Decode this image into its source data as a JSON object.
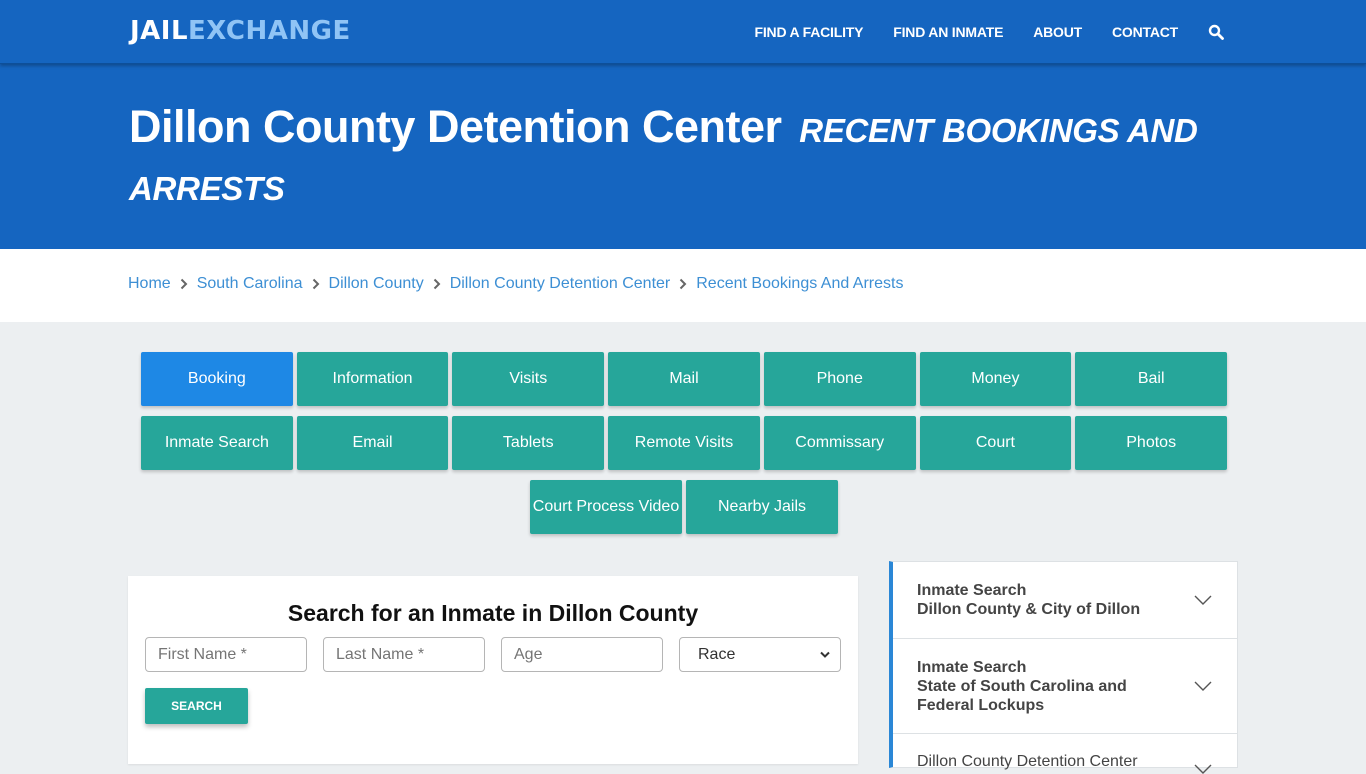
{
  "nav": {
    "logo_part1": "JAIL",
    "logo_part2": "EXCHANGE",
    "links": [
      "FIND A FACILITY",
      "FIND AN INMATE",
      "ABOUT",
      "CONTACT"
    ],
    "search_icon": "search-icon"
  },
  "hero": {
    "title": "Dillon County Detention Center",
    "subtitle": "RECENT BOOKINGS AND ARRESTS"
  },
  "breadcrumb": [
    "Home",
    "South Carolina",
    "Dillon County",
    "Dillon County Detention Center",
    "Recent Bookings And Arrests"
  ],
  "tiles": {
    "row1": [
      "Booking",
      "Information",
      "Visits",
      "Mail",
      "Phone",
      "Money",
      "Bail"
    ],
    "row2": [
      "Inmate Search",
      "Email",
      "Tablets",
      "Remote Visits",
      "Commissary",
      "Court",
      "Photos"
    ],
    "row3": [
      "Court Process Video",
      "Nearby Jails"
    ],
    "active": "Booking"
  },
  "search": {
    "title": "Search for an Inmate in Dillon County",
    "first_name_placeholder": "First Name *",
    "last_name_placeholder": "Last Name *",
    "age_placeholder": "Age",
    "race_selected": "Race",
    "button_label": "SEARCH"
  },
  "sidebar": {
    "items": [
      {
        "line1": "Inmate Search",
        "line2": "Dillon County & City of Dillon"
      },
      {
        "line1": "Inmate Search",
        "line2": "State of South Carolina and Federal Lockups"
      },
      {
        "line1": "Dillon County Detention Center",
        "line2": ""
      }
    ]
  },
  "colors": {
    "brand_blue": "#1565c0",
    "logo_accent": "#90c4f5",
    "tile_teal": "#26a69a",
    "tile_active": "#1e88e5",
    "link_blue": "#3d8fd4"
  }
}
